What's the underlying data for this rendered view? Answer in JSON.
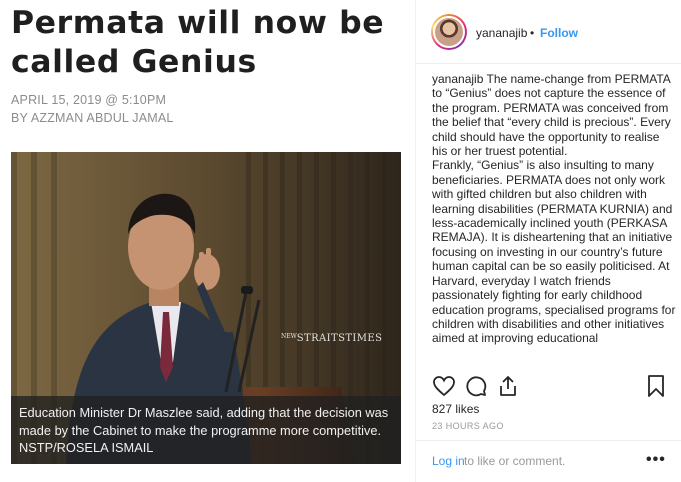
{
  "article": {
    "headline": "Permata will now be called Genius",
    "date": "APRIL 15, 2019 @ 5:10PM",
    "byline": "BY AZZMAN ABDUL JAMAL",
    "watermark": "STRAITSTIMES",
    "watermark_prefix": "NEW",
    "photo_caption": "Education Minister Dr Maszlee said, adding that the decision was made by the Cabinet to make the programme more competitive. NSTP/ROSELA ISMAIL"
  },
  "instagram": {
    "username": "yananajib",
    "separator": "•",
    "follow_label": "Follow",
    "caption_username": "yananajib",
    "caption_p1": "The name-change from PERMATA to “Genius” does not capture the essence of the program. PERMATA was conceived from the belief that “every child is precious”. Every child should have the opportunity to realise his or her truest potential.",
    "caption_p2": "Frankly, “Genius” is also insulting to many beneficiaries. PERMATA does not only work with gifted children but also children with learning disabilities (PERMATA KURNIA) and less-academically inclined youth (PERKASA REMAJA). It is disheartening that an initiative focusing on investing in our country’s future human capital can be so easily politicised. At Harvard, everyday I watch friends passionately fighting for early childhood education programs, specialised programs for children with disabilities and other initiatives aimed at improving educational",
    "likes": "827 likes",
    "timestamp": "23 HOURS AGO",
    "login_label": "Log in",
    "login_rest": "to like or comment.",
    "more_label": "•••",
    "icons": [
      "heart-icon",
      "comment-icon",
      "share-icon",
      "bookmark-icon"
    ]
  }
}
